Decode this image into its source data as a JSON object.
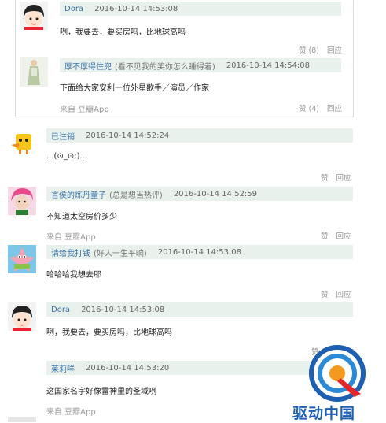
{
  "comments": [
    {
      "user": "Dora",
      "note": "",
      "time": "2016-10-14 14:53:08",
      "text": "咧，我要去，要买房吗，比地球高吗",
      "like": "赞 (8)",
      "reply": "回应",
      "source": ""
    },
    {
      "user": "厚不厚得住兜",
      "note": "(看不见我的奖你怎么睡得着)",
      "time": "2016-10-14 14:54:08",
      "text": "下面给大家安利一位外星歌手／演员／作家",
      "like": "赞 (4)",
      "reply": "回应",
      "source": "来自 豆瓣App"
    },
    {
      "user": "已注销",
      "note": "",
      "time": "2016-10-14 14:52:24",
      "text": "...(⊙_⊙;)...",
      "like": "赞",
      "reply": "回应",
      "source": ""
    },
    {
      "user": "言侯的炼丹童子",
      "note": "(总是想当热评)",
      "time": "2016-10-14 14:52:59",
      "text": "不知道太空房价多少",
      "like": "赞",
      "reply": "回应",
      "source": "来自 豆瓣App"
    },
    {
      "user": "请给我打钱",
      "note": "(好人一生平晌)",
      "time": "2016-10-14 14:53:08",
      "text": "哈哈哈我想去耶",
      "like": "赞",
      "reply": "回应",
      "source": ""
    },
    {
      "user": "Dora",
      "note": "",
      "time": "2016-10-14 14:53:08",
      "text": "咧，我要去，要买房吗，比地球高吗",
      "like": "赞 (8)",
      "reply": "回应",
      "source": ""
    },
    {
      "user": "茱莉咩",
      "note": "",
      "time": "2016-10-14 14:53:20",
      "text": "这国家名字好像雷神里的圣域咧",
      "like": "",
      "reply": "",
      "source": "来自 豆瓣App"
    }
  ],
  "watermark": "驱动中国",
  "icons": [
    "avatar-girl",
    "avatar-boy-green",
    "avatar-yellow-duck",
    "avatar-pink-hair",
    "avatar-patrick-star"
  ],
  "colors": {
    "username": "#3a73a8",
    "header_bg": "#e9f1ec",
    "muted": "#999999",
    "watermark": "#1d5fb0"
  }
}
